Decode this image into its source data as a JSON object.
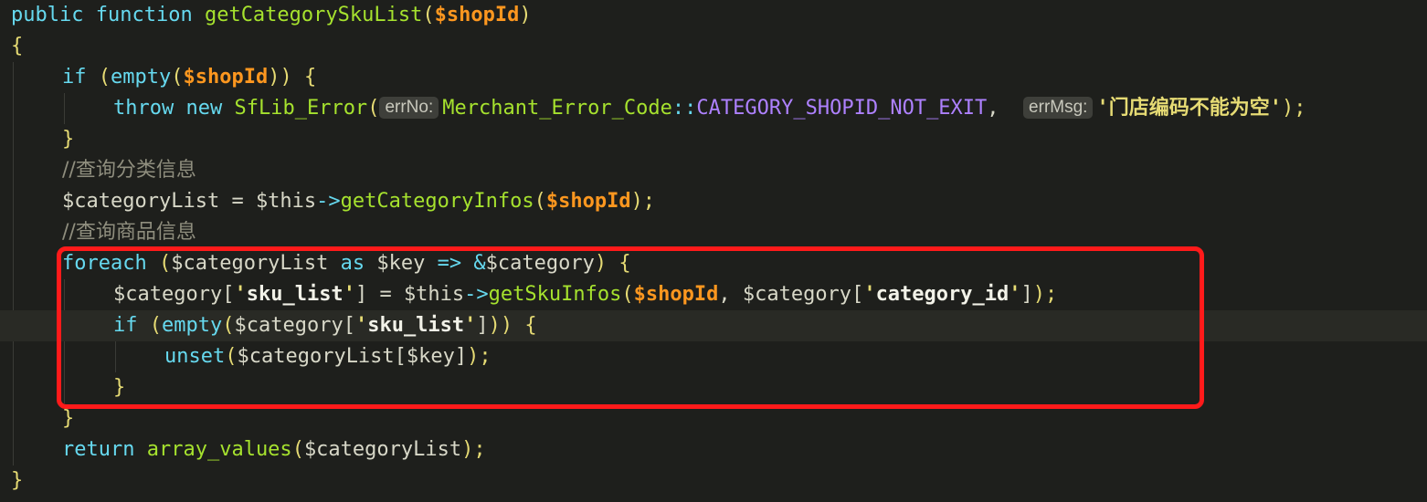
{
  "code": {
    "l1": {
      "kw_public": "public",
      "kw_function": "function",
      "fn_name": "getCategorySkuList",
      "open": "(",
      "param": "$shopId",
      "close": ")"
    },
    "l2": {
      "brace": "{"
    },
    "l3": {
      "kw_if": "if",
      "open": "(",
      "fn_empty": "empty",
      "open2": "(",
      "param": "$shopId",
      "close": "))",
      "brace": "{"
    },
    "l4": {
      "kw_throw": "throw",
      "kw_new": "new",
      "cls": "SfLib_Error",
      "open": "(",
      "hint1": "errNo:",
      "err_class": "Merchant_Error_Code",
      "dcolon": "::",
      "const": "CATEGORY_SHOPID_NOT_EXIT",
      "comma": ",",
      "hint2": "errMsg:",
      "q1": "'",
      "msg": "门店编码不能为空",
      "q2": "'",
      "close": ");"
    },
    "l5": {
      "brace": "}"
    },
    "l6": {
      "comment": "//查询分类信息"
    },
    "l7": {
      "var": "$categoryList",
      "eq": "=",
      "this": "$this",
      "arrow": "->",
      "fn": "getCategoryInfos",
      "open": "(",
      "param": "$shopId",
      "close": ");"
    },
    "l8": {
      "comment": "//查询商品信息"
    },
    "l9": {
      "kw_foreach": "foreach",
      "open": "(",
      "var": "$categoryList",
      "kw_as": "as",
      "key": "$key",
      "op": "=>",
      "amp": "&",
      "cat": "$category",
      "close": ")",
      "brace": "{"
    },
    "l10": {
      "var": "$category",
      "lb": "[",
      "q1": "'",
      "key": "sku_list",
      "q2": "'",
      "rb": "]",
      "eq": "=",
      "this": "$this",
      "arrow": "->",
      "fn": "getSkuInfos",
      "open": "(",
      "param": "$shopId",
      "comma": ",",
      "var2": "$category",
      "lb2": "[",
      "q3": "'",
      "key2": "category_id",
      "q4": "'",
      "rb2": "]",
      "close": ");"
    },
    "l11": {
      "kw_if": "if",
      "open": "(",
      "fn_empty": "empty",
      "open2": "(",
      "var": "$category",
      "lb": "[",
      "q1": "'",
      "key": "sku_list",
      "q2": "'",
      "rb": "]",
      "close": "))",
      "brace": "{"
    },
    "l12": {
      "fn_unset": "unset",
      "open": "(",
      "var": "$categoryList",
      "lb": "[",
      "key": "$key",
      "rb": "]",
      "close": ");"
    },
    "l13": {
      "brace": "}"
    },
    "l14": {
      "brace": "}"
    },
    "l15": {
      "kw_return": "return",
      "fn": "array_values",
      "open": "(",
      "var": "$categoryList",
      "close": ");"
    },
    "l16": {
      "brace": "}"
    }
  },
  "colors": {
    "background": "#1e1f1c",
    "keyword": "#66d9ef",
    "function": "#a6e22e",
    "parameter": "#fd971f",
    "string": "#e6db74",
    "constant": "#ae81ff",
    "comment": "#8f8e7e",
    "annotation_box": "#ff1a1a"
  }
}
